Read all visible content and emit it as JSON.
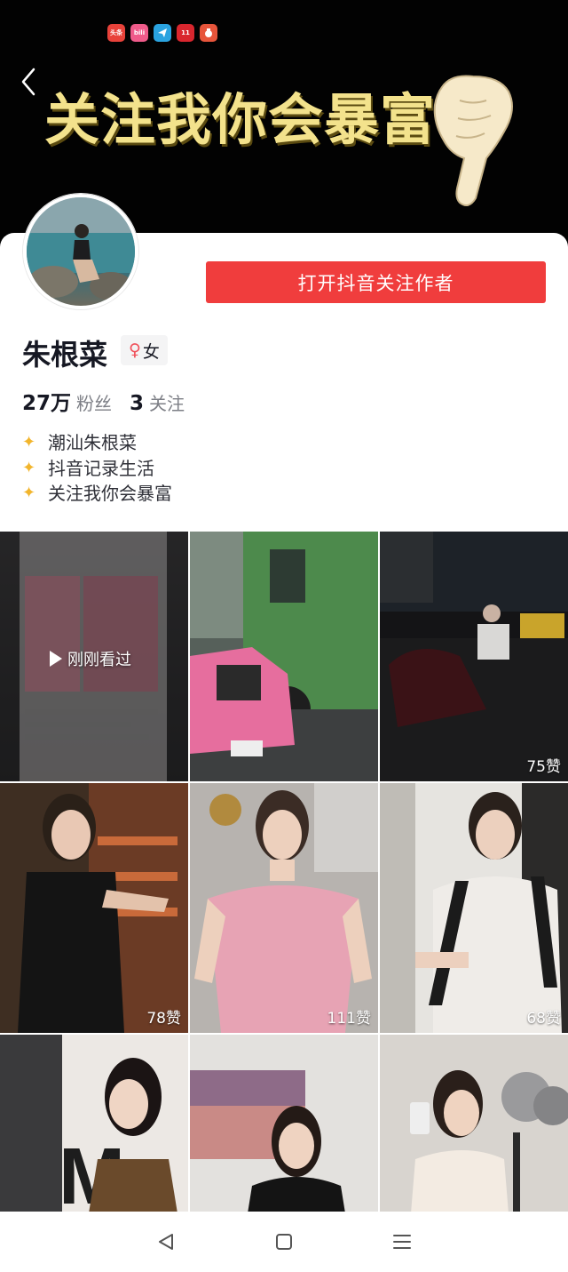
{
  "header": {
    "banner_text": "关注我你会暴富",
    "status_icons": [
      {
        "name": "toutiao-icon",
        "label": "头条",
        "color": "#e8423a"
      },
      {
        "name": "bilibili-icon",
        "label": "bili",
        "color": "#ef5b8a"
      },
      {
        "name": "telegram-icon",
        "label": "",
        "color": "#2aa3e0"
      },
      {
        "name": "taobao-icon",
        "label": "11",
        "color": "#d9262e"
      },
      {
        "name": "red-app-icon",
        "label": "",
        "color": "#e7553b"
      }
    ]
  },
  "profile": {
    "follow_button": "打开抖音关注作者",
    "name": "朱根菜",
    "gender_symbol": "♀",
    "gender": "女",
    "followers_count": "27万",
    "followers_label": "粉丝",
    "following_count": "3",
    "following_label": "关注",
    "bio": [
      "潮汕朱根菜",
      "抖音记录生活",
      "关注我你会暴富"
    ]
  },
  "videos": [
    {
      "badge": "刚刚看过",
      "likes": ""
    },
    {
      "badge": "",
      "likes": ""
    },
    {
      "badge": "",
      "likes": "75赞"
    },
    {
      "badge": "",
      "likes": "78赞"
    },
    {
      "badge": "",
      "likes": "111赞"
    },
    {
      "badge": "",
      "likes": "68赞"
    },
    {
      "badge": "",
      "likes": ""
    },
    {
      "badge": "",
      "likes": ""
    },
    {
      "badge": "",
      "likes": ""
    }
  ],
  "colors": {
    "accent": "#f03d3d",
    "header_bg": "#020202",
    "banner_gold": "#f3e28c"
  }
}
